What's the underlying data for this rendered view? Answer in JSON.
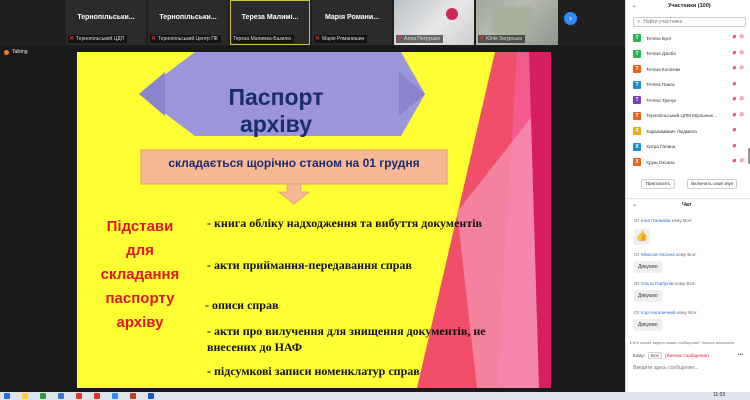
{
  "colors": {
    "slide_bg": "#ffff33",
    "title_banner": "#9b96dc",
    "title_text": "#1b2c6e",
    "subtitle_box": "#f7b995",
    "left_label": "#e01820",
    "pink_accent": "#ee2f73",
    "zoom_blue": "#2d8cff",
    "mic_off": "#e13333"
  },
  "video_strip": {
    "tiles": [
      {
        "name": "Тернопільськи...",
        "caption": "Тернопільський ЦДП"
      },
      {
        "name": "Тернопільськи...",
        "caption": "Тернопільський Центр ПК"
      },
      {
        "name": "Тереза  Малимі...",
        "caption": "Тереза Малимка-Базилю"
      },
      {
        "name": "Марія  Романи...",
        "caption": "Марія Романишин"
      },
      {
        "name": "",
        "caption": "Алла Петрушко"
      },
      {
        "name": "",
        "caption": "Юлія Загурська"
      }
    ],
    "next_icon": "chevron-right-icon"
  },
  "speaker_label": "Talking",
  "slide": {
    "title": "Паспорт архіву",
    "subtitle": "складається щорічно станом на 01 грудня",
    "left_label_lines": [
      "Підстави",
      "для",
      "складання",
      "паспорту",
      "архіву"
    ],
    "bullets": [
      [
        "- книга обліку надходження та вибуття документів"
      ],
      [
        "- акти приймання-передавання справ"
      ],
      [
        "- описи справ"
      ],
      [
        "- акти про вилучення для знищення документів,  не",
        "внесених до НАФ"
      ],
      [
        "- підсумкові записи номенклатур справ"
      ]
    ]
  },
  "participants_panel": {
    "title": "Участники (100)",
    "search_placeholder": "Найти участника",
    "participants": [
      {
        "initial": "Т",
        "color": "#2bb24c",
        "name": "Тетяна Бунт"
      },
      {
        "initial": "Т",
        "color": "#2bb24c",
        "name": "Тетяна Дзюба"
      },
      {
        "initial": "Т",
        "color": "#e8641c",
        "name": "Тетяна Колісник"
      },
      {
        "initial": "Т",
        "color": "#1b8bd8",
        "name": "Тетяна Панас"
      },
      {
        "initial": "Т",
        "color": "#7b3fb4",
        "name": "Тетяна Трачук"
      },
      {
        "initial": "Т",
        "color": "#e8641c",
        "name": "Тернопільський ЦПМ Мірошник..."
      },
      {
        "initial": "Х",
        "color": "#f0a81e",
        "name": "Харалимківич Людмила"
      },
      {
        "initial": "Х",
        "color": "#1b8bd8",
        "name": "Хитра Галина"
      },
      {
        "initial": "Х",
        "color": "#e8641c",
        "name": "Хрущ Оксана"
      }
    ],
    "invite_button": "Пригласить",
    "unmute_button": "Включить свой звук"
  },
  "chat": {
    "title": "Чат",
    "from_prefix": "От",
    "to_everyone": "кому Все:",
    "messages": [
      {
        "from": "Інна Палмова",
        "text": "👍"
      },
      {
        "from": "Мікасов Оксана",
        "text": "Дякуємо"
      },
      {
        "from": "Ольга Горбулім",
        "text": "Дякуємо"
      },
      {
        "from": "Ігор Нагаличний",
        "text": "Дякуємо"
      }
    ],
    "note": "ℹ Кто может видеть ваши сообщения? Запись включена",
    "to_label": "Кому:",
    "to_value": "Все",
    "private_label": "(Личное сообщение)",
    "more_label": "•••",
    "input_placeholder": "Введите здесь сообщение..."
  },
  "taskbar": {
    "clock": "11:03"
  }
}
